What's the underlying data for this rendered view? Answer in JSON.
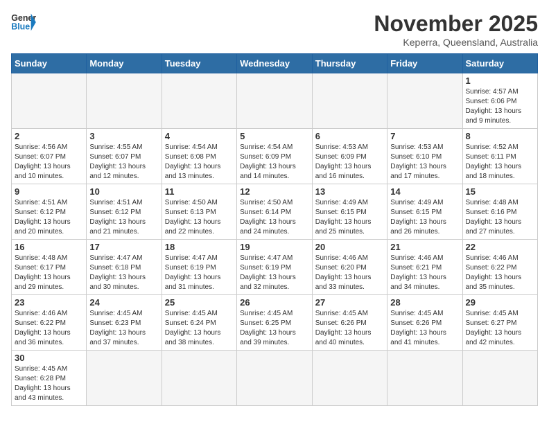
{
  "header": {
    "logo_general": "General",
    "logo_blue": "Blue",
    "month_title": "November 2025",
    "location": "Keperra, Queensland, Australia"
  },
  "days_of_week": [
    "Sunday",
    "Monday",
    "Tuesday",
    "Wednesday",
    "Thursday",
    "Friday",
    "Saturday"
  ],
  "weeks": [
    [
      {
        "day": "",
        "info": ""
      },
      {
        "day": "",
        "info": ""
      },
      {
        "day": "",
        "info": ""
      },
      {
        "day": "",
        "info": ""
      },
      {
        "day": "",
        "info": ""
      },
      {
        "day": "",
        "info": ""
      },
      {
        "day": "1",
        "info": "Sunrise: 4:57 AM\nSunset: 6:06 PM\nDaylight: 13 hours and 9 minutes."
      }
    ],
    [
      {
        "day": "2",
        "info": "Sunrise: 4:56 AM\nSunset: 6:07 PM\nDaylight: 13 hours and 10 minutes."
      },
      {
        "day": "3",
        "info": "Sunrise: 4:55 AM\nSunset: 6:07 PM\nDaylight: 13 hours and 12 minutes."
      },
      {
        "day": "4",
        "info": "Sunrise: 4:54 AM\nSunset: 6:08 PM\nDaylight: 13 hours and 13 minutes."
      },
      {
        "day": "5",
        "info": "Sunrise: 4:54 AM\nSunset: 6:09 PM\nDaylight: 13 hours and 14 minutes."
      },
      {
        "day": "6",
        "info": "Sunrise: 4:53 AM\nSunset: 6:09 PM\nDaylight: 13 hours and 16 minutes."
      },
      {
        "day": "7",
        "info": "Sunrise: 4:53 AM\nSunset: 6:10 PM\nDaylight: 13 hours and 17 minutes."
      },
      {
        "day": "8",
        "info": "Sunrise: 4:52 AM\nSunset: 6:11 PM\nDaylight: 13 hours and 18 minutes."
      }
    ],
    [
      {
        "day": "9",
        "info": "Sunrise: 4:51 AM\nSunset: 6:12 PM\nDaylight: 13 hours and 20 minutes."
      },
      {
        "day": "10",
        "info": "Sunrise: 4:51 AM\nSunset: 6:12 PM\nDaylight: 13 hours and 21 minutes."
      },
      {
        "day": "11",
        "info": "Sunrise: 4:50 AM\nSunset: 6:13 PM\nDaylight: 13 hours and 22 minutes."
      },
      {
        "day": "12",
        "info": "Sunrise: 4:50 AM\nSunset: 6:14 PM\nDaylight: 13 hours and 24 minutes."
      },
      {
        "day": "13",
        "info": "Sunrise: 4:49 AM\nSunset: 6:15 PM\nDaylight: 13 hours and 25 minutes."
      },
      {
        "day": "14",
        "info": "Sunrise: 4:49 AM\nSunset: 6:15 PM\nDaylight: 13 hours and 26 minutes."
      },
      {
        "day": "15",
        "info": "Sunrise: 4:48 AM\nSunset: 6:16 PM\nDaylight: 13 hours and 27 minutes."
      }
    ],
    [
      {
        "day": "16",
        "info": "Sunrise: 4:48 AM\nSunset: 6:17 PM\nDaylight: 13 hours and 29 minutes."
      },
      {
        "day": "17",
        "info": "Sunrise: 4:47 AM\nSunset: 6:18 PM\nDaylight: 13 hours and 30 minutes."
      },
      {
        "day": "18",
        "info": "Sunrise: 4:47 AM\nSunset: 6:19 PM\nDaylight: 13 hours and 31 minutes."
      },
      {
        "day": "19",
        "info": "Sunrise: 4:47 AM\nSunset: 6:19 PM\nDaylight: 13 hours and 32 minutes."
      },
      {
        "day": "20",
        "info": "Sunrise: 4:46 AM\nSunset: 6:20 PM\nDaylight: 13 hours and 33 minutes."
      },
      {
        "day": "21",
        "info": "Sunrise: 4:46 AM\nSunset: 6:21 PM\nDaylight: 13 hours and 34 minutes."
      },
      {
        "day": "22",
        "info": "Sunrise: 4:46 AM\nSunset: 6:22 PM\nDaylight: 13 hours and 35 minutes."
      }
    ],
    [
      {
        "day": "23",
        "info": "Sunrise: 4:46 AM\nSunset: 6:22 PM\nDaylight: 13 hours and 36 minutes."
      },
      {
        "day": "24",
        "info": "Sunrise: 4:45 AM\nSunset: 6:23 PM\nDaylight: 13 hours and 37 minutes."
      },
      {
        "day": "25",
        "info": "Sunrise: 4:45 AM\nSunset: 6:24 PM\nDaylight: 13 hours and 38 minutes."
      },
      {
        "day": "26",
        "info": "Sunrise: 4:45 AM\nSunset: 6:25 PM\nDaylight: 13 hours and 39 minutes."
      },
      {
        "day": "27",
        "info": "Sunrise: 4:45 AM\nSunset: 6:26 PM\nDaylight: 13 hours and 40 minutes."
      },
      {
        "day": "28",
        "info": "Sunrise: 4:45 AM\nSunset: 6:26 PM\nDaylight: 13 hours and 41 minutes."
      },
      {
        "day": "29",
        "info": "Sunrise: 4:45 AM\nSunset: 6:27 PM\nDaylight: 13 hours and 42 minutes."
      }
    ],
    [
      {
        "day": "30",
        "info": "Sunrise: 4:45 AM\nSunset: 6:28 PM\nDaylight: 13 hours and 43 minutes."
      },
      {
        "day": "",
        "info": ""
      },
      {
        "day": "",
        "info": ""
      },
      {
        "day": "",
        "info": ""
      },
      {
        "day": "",
        "info": ""
      },
      {
        "day": "",
        "info": ""
      },
      {
        "day": "",
        "info": ""
      }
    ]
  ]
}
